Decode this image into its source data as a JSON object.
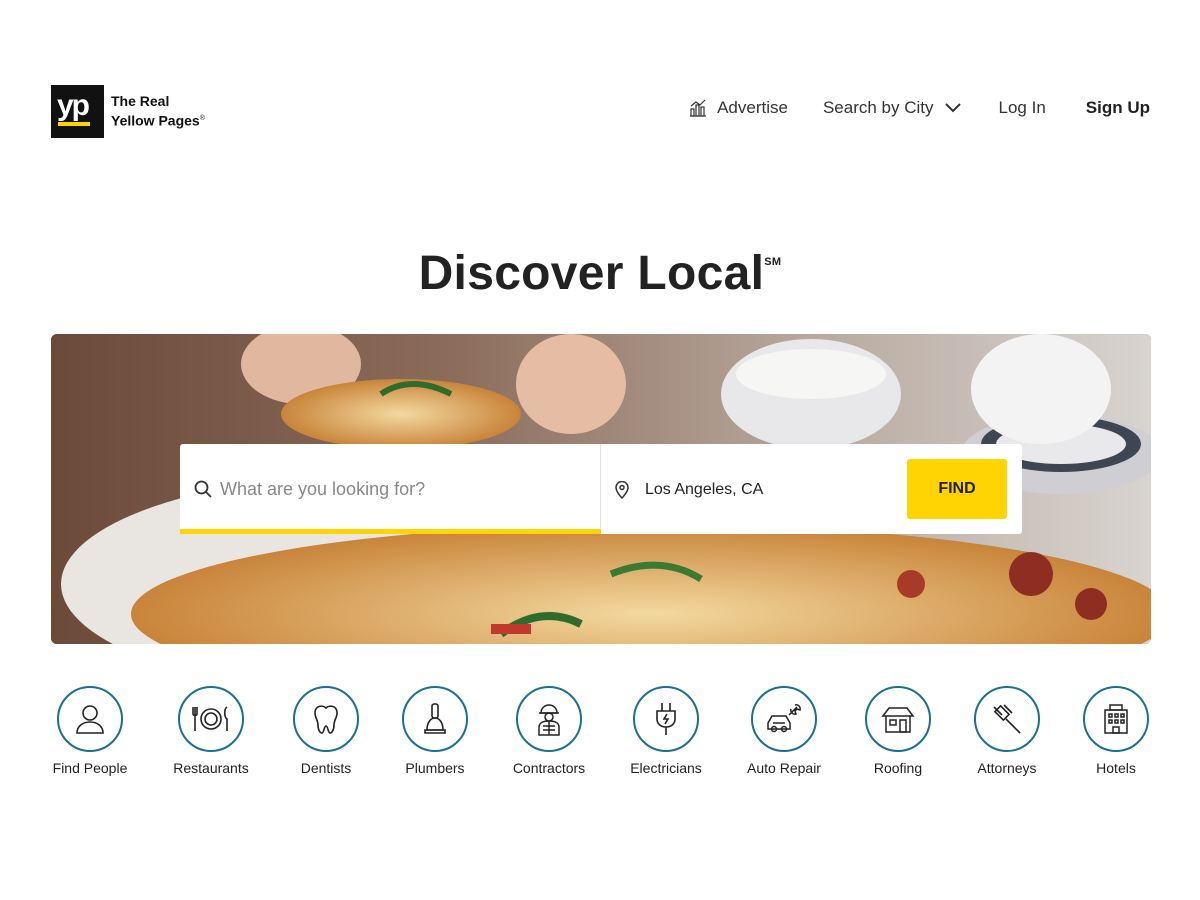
{
  "header": {
    "logo": {
      "mark": "yp",
      "line1": "The Real",
      "line2": "Yellow Pages",
      "reg": "®"
    },
    "nav": {
      "advertise": "Advertise",
      "search_by_city": "Search by City",
      "log_in": "Log In",
      "sign_up": "Sign Up"
    }
  },
  "hero": {
    "title": "Discover Local",
    "mark": "SM"
  },
  "search": {
    "what_placeholder": "What are you looking for?",
    "where_value": "Los Angeles, CA",
    "find_label": "FIND"
  },
  "colors": {
    "accent_yellow": "#ffd400",
    "icon_blue": "#1b6e94",
    "text_dark": "#222222"
  },
  "categories": [
    {
      "label": "Find People",
      "icon": "person-icon"
    },
    {
      "label": "Restaurants",
      "icon": "plate-cutlery-icon"
    },
    {
      "label": "Dentists",
      "icon": "tooth-icon"
    },
    {
      "label": "Plumbers",
      "icon": "plunger-icon"
    },
    {
      "label": "Contractors",
      "icon": "worker-icon"
    },
    {
      "label": "Electricians",
      "icon": "plug-icon"
    },
    {
      "label": "Auto Repair",
      "icon": "car-wrench-icon"
    },
    {
      "label": "Roofing",
      "icon": "house-icon"
    },
    {
      "label": "Attorneys",
      "icon": "gavel-icon"
    },
    {
      "label": "Hotels",
      "icon": "hotel-icon"
    }
  ]
}
